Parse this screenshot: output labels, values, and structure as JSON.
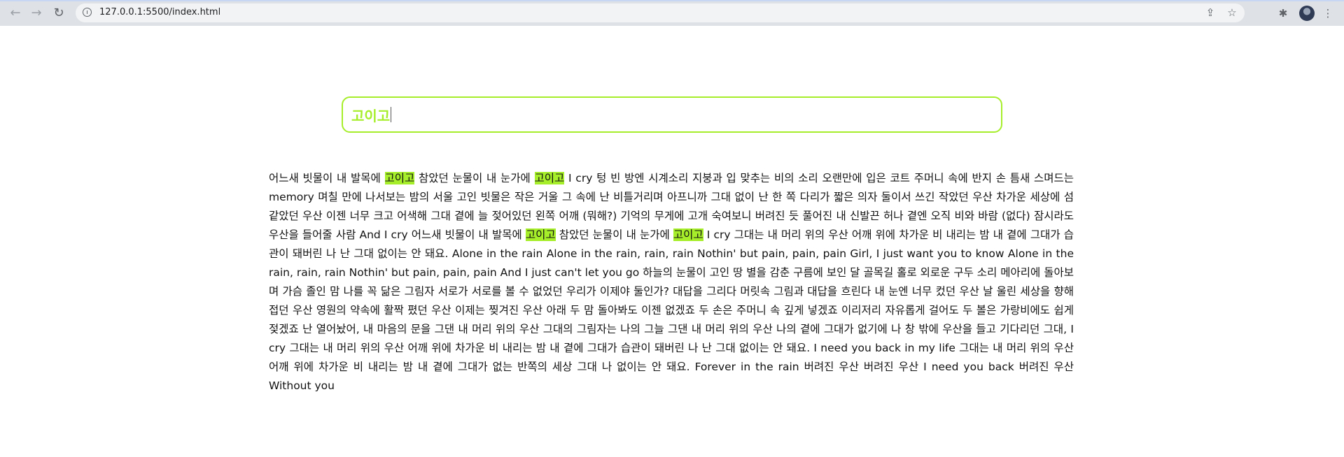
{
  "browser": {
    "url": "127.0.0.1:5500/index.html",
    "back_icon": "arrow-left-icon",
    "forward_icon": "arrow-right-icon",
    "reload_icon": "reload-icon",
    "toolbar_icons": [
      "share-icon",
      "star-icon",
      "puzzle-icon",
      "avatar",
      "kebab-menu-icon"
    ]
  },
  "search": {
    "query": "고이고",
    "accent_color": "#a6ee2a"
  },
  "lyrics": {
    "segments": [
      {
        "text": "어느새 빗물이 내 발목에 ",
        "highlight": false
      },
      {
        "text": "고이고",
        "highlight": true
      },
      {
        "text": " 참았던 눈물이 내 눈가에 ",
        "highlight": false
      },
      {
        "text": "고이고",
        "highlight": true
      },
      {
        "text": " I cry 텅 빈 방엔 시계소리 지붕과 입 맞추는 비의 소리 오랜만에 입은 코트 주머니 속에 반지 손 틈새 스며드는 memory 며칠 만에 나서보는 밤의 서울 고인 빗물은 작은 거울 그 속에 난 비틀거리며 아프니까 그대 없이 난 한 쪽 다리가 짧은 의자 둘이서 쓰긴 작았던 우산 차가운 세상에 섬 같았던 우산 이젠 너무 크고 어색해 그대 곁에 늘 젖어있던 왼쪽 어깨 (뭐해?) 기억의 무게에 고개 숙여보니 버려진 듯 풀어진 내 신발끈 허나 곁엔 오직 비와 바람 (없다) 잠시라도 우산을 들어줄 사람 And I cry 어느새 빗물이 내 발목에 ",
        "highlight": false
      },
      {
        "text": "고이고",
        "highlight": true
      },
      {
        "text": " 참았던 눈물이 내 눈가에 ",
        "highlight": false
      },
      {
        "text": "고이고",
        "highlight": true
      },
      {
        "text": " I cry 그대는 내 머리 위의 우산 어깨 위에 차가운 비 내리는 밤 내 곁에 그대가 습관이 돼버린 나 난 그대 없이는 안 돼요. Alone in the rain Alone in the rain, rain, rain Nothin' but pain, pain, pain Girl, I just want you to know Alone in the rain, rain, rain Nothin' but pain, pain, pain And I just can't let you go 하늘의 눈물이 고인 땅 별을 감춘 구름에 보인 달 골목길 홀로 외로운 구두 소리 메아리에 돌아보며 가슴 졸인 맘 나를 꼭 닮은 그림자 서로가 서로를 볼 수 없었던 우리가 이제야 둘인가? 대답을 그리다 머릿속 그림과 대답을 흐린다 내 눈엔 너무 컸던 우산 날 울린 세상을 향해 접던 우산 영원의 약속에 활짝 폈던 우산 이제는 찢겨진 우산 아래 두 맘 돌아봐도 이젠 없겠죠 두 손은 주머니 속 깊게 넣겠죠 이리저리 자유롭게 걸어도 두 볼은 가랑비에도 쉽게 젖겠죠 난 열어놨어, 내 마음의 문을 그댄 내 머리 위의 우산 그대의 그림자는 나의 그늘 그댄 내 머리 위의 우산 나의 곁에 그대가 없기에 나 창 밖에 우산을 들고 기다리던 그대, I cry 그대는 내 머리 위의 우산 어깨 위에 차가운 비 내리는 밤 내 곁에 그대가 습관이 돼버린 나 난 그대 없이는 안 돼요. I need you back in my life 그대는 내 머리 위의 우산 어깨 위에 차가운 비 내리는 밤 내 곁에 그대가 없는 반쪽의 세상 그대 나 없이는 안 돼요. Forever in the rain 버려진 우산 버려진 우산 I need you back 버려진 우산 Without you",
        "highlight": false
      }
    ]
  }
}
